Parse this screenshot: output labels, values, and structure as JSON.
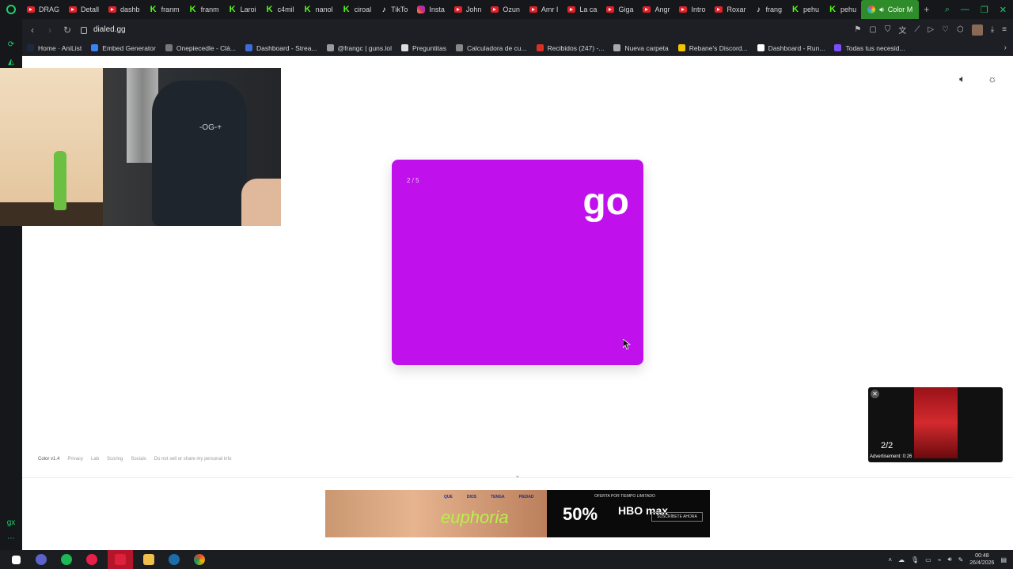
{
  "tabs": [
    {
      "label": "DRAG",
      "icon": "yt"
    },
    {
      "label": "Detall",
      "icon": "yt"
    },
    {
      "label": "dashb",
      "icon": "yt"
    },
    {
      "label": "franm",
      "icon": "kick"
    },
    {
      "label": "franm",
      "icon": "kick"
    },
    {
      "label": "Laroi",
      "icon": "kick"
    },
    {
      "label": "c4mil",
      "icon": "kick"
    },
    {
      "label": "nanol",
      "icon": "kick"
    },
    {
      "label": "ciroal",
      "icon": "kick"
    },
    {
      "label": "TikTo",
      "icon": "tt"
    },
    {
      "label": "Insta",
      "icon": "ig"
    },
    {
      "label": "John",
      "icon": "yt"
    },
    {
      "label": "Ozun",
      "icon": "yt"
    },
    {
      "label": "Amr I",
      "icon": "yt"
    },
    {
      "label": "La ca",
      "icon": "yt"
    },
    {
      "label": "Giga",
      "icon": "yt"
    },
    {
      "label": "Angr",
      "icon": "yt"
    },
    {
      "label": "Intro",
      "icon": "yt"
    },
    {
      "label": "Roxar",
      "icon": "yt"
    },
    {
      "label": "frang",
      "icon": "tt"
    },
    {
      "label": "pehu",
      "icon": "kick"
    },
    {
      "label": "pehu",
      "icon": "kick"
    }
  ],
  "active_tab": "Color M",
  "new_tab": "+",
  "url": "dialed.gg",
  "bookmarks": [
    {
      "label": "Home · AniList",
      "color": "#1b2a3f"
    },
    {
      "label": "Embed Generator",
      "color": "#3b82f6"
    },
    {
      "label": "Onepiecedle - Clá...",
      "color": "#777777"
    },
    {
      "label": "Dashboard - Strea...",
      "color": "#3f6bd8"
    },
    {
      "label": "@frangc | guns.lol",
      "color": "#9a9a9a"
    },
    {
      "label": "Preguntitas",
      "color": "#dddddd"
    },
    {
      "label": "Calculadora de cu...",
      "color": "#888888"
    },
    {
      "label": "Recibidos (247) -...",
      "color": "#d93025"
    },
    {
      "label": "Nueva carpeta",
      "color": "#aaaaaa"
    },
    {
      "label": "Rebane's Discord...",
      "color": "#f5c400"
    },
    {
      "label": "Dashboard - Run...",
      "color": "#ffffff"
    },
    {
      "label": "Todas tus necesid...",
      "color": "#7c4dff"
    }
  ],
  "game": {
    "progress": "2 / 5",
    "word": "go",
    "card_color": "#c010ec"
  },
  "webcam_overlay": {
    "chair_logo": "-OG-+"
  },
  "footer": [
    "Color v1.4",
    "Privacy",
    "Lab",
    "Scoring",
    "Socials",
    "Do not sell or share my personal info"
  ],
  "mini_player": {
    "count": "2/2",
    "ad_label": "Advertisement: 0:26"
  },
  "ad": {
    "tags": [
      "QUE",
      "DIOS",
      "TENGA",
      "PIEDAD"
    ],
    "brand": "euphoria",
    "offer": "OFERTA POR TIEMPO LIMITADO",
    "percent": "50%",
    "hbo": "HBO max",
    "cta": "SUSCRÍBETE AHORA"
  },
  "clock": {
    "time": "00:48",
    "date": "26/4/2026"
  }
}
